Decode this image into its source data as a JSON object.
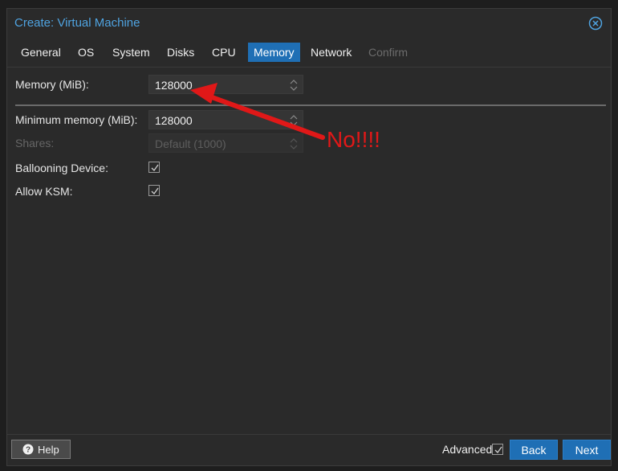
{
  "window": {
    "title": "Create: Virtual Machine"
  },
  "tabs": [
    {
      "label": "General",
      "state": "normal"
    },
    {
      "label": "OS",
      "state": "normal"
    },
    {
      "label": "System",
      "state": "normal"
    },
    {
      "label": "Disks",
      "state": "normal"
    },
    {
      "label": "CPU",
      "state": "normal"
    },
    {
      "label": "Memory",
      "state": "active"
    },
    {
      "label": "Network",
      "state": "normal"
    },
    {
      "label": "Confirm",
      "state": "disabled"
    }
  ],
  "form": {
    "memory": {
      "label": "Memory (MiB):",
      "value": "128000"
    },
    "min_memory": {
      "label": "Minimum memory (MiB):",
      "value": "128000"
    },
    "shares": {
      "label": "Shares:",
      "placeholder": "Default (1000)"
    },
    "ballooning": {
      "label": "Ballooning Device:",
      "checked": true
    },
    "ksm": {
      "label": "Allow KSM:",
      "checked": true
    }
  },
  "annotation": {
    "text": "No!!!!",
    "color": "#e01818"
  },
  "footer": {
    "help_label": "Help",
    "advanced_label": "Advanced",
    "advanced_checked": true,
    "back_label": "Back",
    "next_label": "Next"
  },
  "colors": {
    "accent": "#1f6fb5",
    "title": "#4fa3e0",
    "background": "#2a2a2a"
  },
  "icons": {
    "close": "close-circle-icon",
    "help": "question-circle-icon",
    "spinner": "spinner-arrows-icon",
    "check": "checkmark-icon"
  }
}
